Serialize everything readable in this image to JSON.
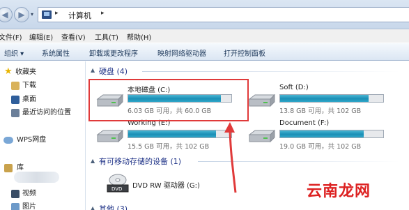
{
  "address": {
    "path": "计算机"
  },
  "menu": [
    "文件(F)",
    "编辑(E)",
    "查看(V)",
    "工具(T)",
    "帮助(H)"
  ],
  "toolbar": {
    "organize": "组织 ▾",
    "items": [
      "系统属性",
      "卸载或更改程序",
      "映射网络驱动器",
      "打开控制面板"
    ]
  },
  "nav": {
    "favorites": "收藏夹",
    "favorites_items": [
      "下载",
      "桌面",
      "最近访问的位置"
    ],
    "wps": "WPS网盘",
    "library": "库",
    "library_items": [
      "视频",
      "图片"
    ]
  },
  "groups": {
    "hdd": "硬盘 (4)",
    "removable": "有可移动存储的设备 (1)",
    "other": "其他 (3)"
  },
  "drives": [
    {
      "name": "本地磁盘 (C:)",
      "info": "6.03 GB 可用，共 60.0 GB",
      "used_fraction": 0.9
    },
    {
      "name": "Soft (D:)",
      "info": "13.8 GB 可用，共 102 GB",
      "used_fraction": 0.86
    },
    {
      "name": "Working (E:)",
      "info": "15.5 GB 可用，共 102 GB",
      "used_fraction": 0.85
    },
    {
      "name": "Document (F:)",
      "info": "19.0 GB 可用，共 102 GB",
      "used_fraction": 0.81
    }
  ],
  "dvd": {
    "name": "DVD RW 驱动器 (G:)",
    "badge": "DVD"
  },
  "watermark": "云南龙网",
  "colors": {
    "highlight": "#e03a3a",
    "bar": "#1a8fb6",
    "group_header": "#1e3287"
  }
}
